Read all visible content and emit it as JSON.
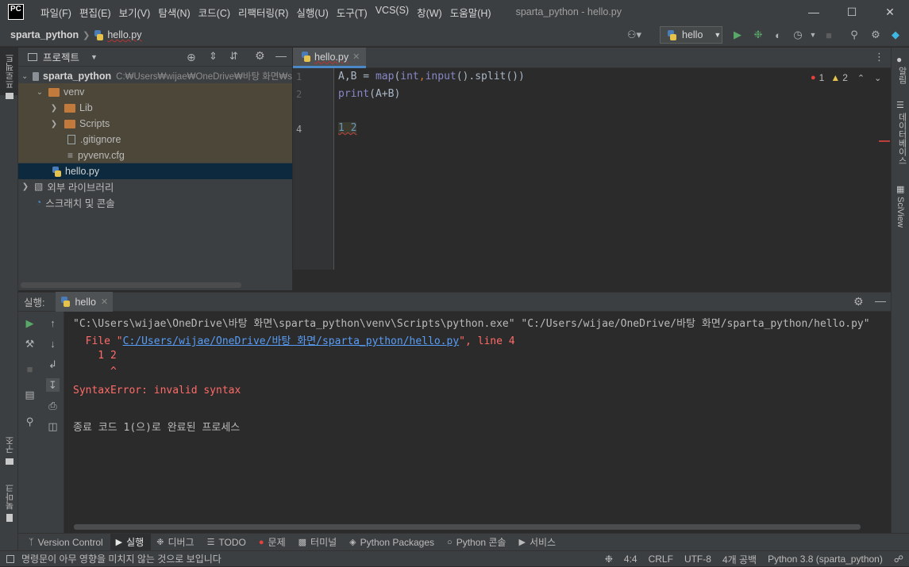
{
  "app": {
    "logo": "PC",
    "window_title": "sparta_python - hello.py"
  },
  "menu": [
    "파일(F)",
    "편집(E)",
    "보기(V)",
    "탐색(N)",
    "코드(C)",
    "리팩터링(R)",
    "실행(U)",
    "도구(T)",
    "VCS(S)",
    "창(W)",
    "도움말(H)"
  ],
  "breadcrumb": {
    "project": "sparta_python",
    "file": "hello.py"
  },
  "toolbar": {
    "run_config": "hello"
  },
  "left_stripe": {
    "project": "프로젝트",
    "structure": "구조",
    "bookmarks": "북마크"
  },
  "right_stripe": {
    "notifications": "알림",
    "database": "데이터베이스",
    "sciview": "SciView"
  },
  "project_panel": {
    "title": "프로젝트",
    "tree": [
      {
        "label": "sparta_python",
        "path": "C:₩Users₩wijae₩OneDrive₩바탕 화면₩s"
      },
      {
        "label": "venv"
      },
      {
        "label": "Lib"
      },
      {
        "label": "Scripts"
      },
      {
        "label": ".gitignore"
      },
      {
        "label": "pyvenv.cfg"
      },
      {
        "label": "hello.py"
      },
      {
        "label": "외부 라이브러리"
      },
      {
        "label": "스크래치 및 콘솔"
      }
    ]
  },
  "editor": {
    "tab": "hello.py",
    "line_numbers": [
      "1",
      "2",
      "4"
    ],
    "lines": {
      "l1_plain1": "A,B = ",
      "l1_fn1": "map",
      "l1_paren": "(",
      "l1_fn2": "int",
      "l1_comma": ",",
      "l1_fn3": "input",
      "l1_rest": "().split())",
      "l2_fn": "print",
      "l2_rest": "(A+B)",
      "l4": "1 2"
    },
    "errors": "1",
    "warnings": "2"
  },
  "run_panel": {
    "label": "실행:",
    "tab": "hello",
    "output": {
      "cmd": "\"C:\\Users\\wijae\\OneDrive\\바탕 화면\\sparta_python\\venv\\Scripts\\python.exe\" \"C:/Users/wijae/OneDrive/바탕 화면/sparta_python/hello.py\"",
      "file_prefix": "  File \"",
      "file_link": "C:/Users/wijae/OneDrive/바탕 화면/sparta_python/hello.py",
      "file_suffix": "\", line 4",
      "src": "    1 2",
      "caret": "      ^",
      "error": "SyntaxError: invalid syntax",
      "exit": "종료 코드 1(으)로 완료된 프로세스"
    }
  },
  "tool_tabs": [
    "Version Control",
    "실행",
    "디버그",
    "TODO",
    "문제",
    "터미널",
    "Python Packages",
    "Python 콘솔",
    "서비스"
  ],
  "status": {
    "message": "명령문이 아무 영향을 미치지 않는 것으로 보입니다",
    "position": "4:4",
    "line_sep": "CRLF",
    "encoding": "UTF-8",
    "indent": "4개 공백",
    "interpreter": "Python 3.8 (sparta_python)"
  },
  "colors": {
    "accent": "#4a88c7",
    "error_red": "#ff6b68",
    "keyword_blue": "#8888c6",
    "selection": "#0d293e"
  }
}
